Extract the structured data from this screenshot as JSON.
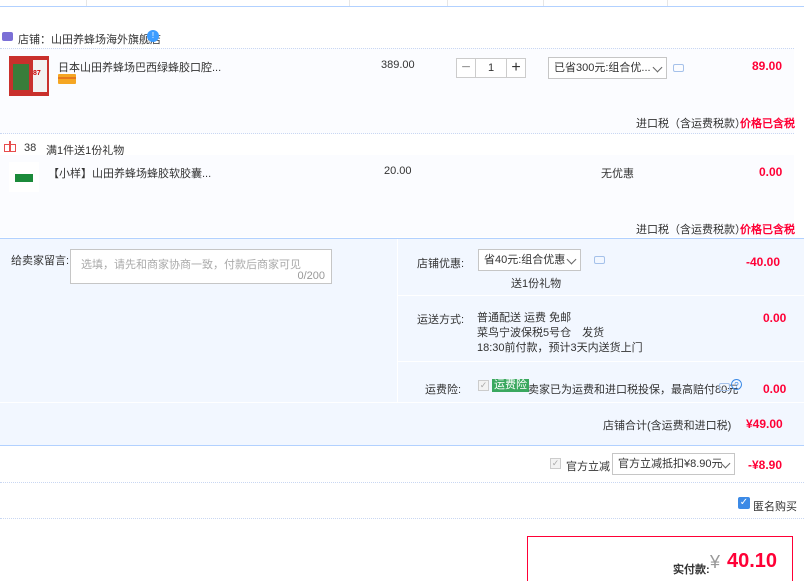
{
  "shop": {
    "label": "店铺：",
    "name": "山田养蜂场海外旗舰店"
  },
  "item1": {
    "title": "日本山田养蜂场巴西绿蜂胶口腔...",
    "thumb_text": "87",
    "price": "389.00",
    "quantity": "1",
    "promo_select": "已省300元:组合优...",
    "subtotal": "89.00",
    "tax_note": "进口税（含运费税款）",
    "tax_status": "价格已含税"
  },
  "gift": {
    "count": "38",
    "text": "满1件送1份礼物",
    "title": "【小样】山田养蜂场蜂胶软胶囊...",
    "price": "20.00",
    "promo": "无优惠",
    "subtotal": "0.00",
    "tax_note": "进口税（含运费税款）",
    "tax_status": "价格已含税"
  },
  "message": {
    "label": "给卖家留言:",
    "placeholder": "选填，请先和商家协商一致，付款后商家可见",
    "counter": "0/200"
  },
  "shop_discount": {
    "label": "店铺优惠:",
    "select": "省40元:组合优惠",
    "gift_note": "送1份礼物",
    "amount": "-40.00"
  },
  "shipping": {
    "label": "运送方式:",
    "line1": "普通配送 运费 免邮",
    "line2": "菜鸟宁波保税5号仓　发货",
    "line3": "18:30前付款，预计3天内送货上门",
    "amount": "0.00"
  },
  "insurance": {
    "label": "运费险:",
    "badge": "运费险",
    "text": "卖家已为运费和进口税投保，最高赔付80元",
    "amount": "0.00"
  },
  "shop_total": {
    "label": "店铺合计(含运费和进口税)",
    "amount": "¥49.00"
  },
  "official": {
    "label": "官方立减",
    "select": "官方立减抵扣¥8.90元",
    "amount": "-¥8.90"
  },
  "anonymous": {
    "label": "匿名购买"
  },
  "payment": {
    "label": "实付款:",
    "currency": "¥",
    "amount": "40.10"
  },
  "colors": {
    "accent_red": "#ff0036",
    "blue_border": "#b2d1ff",
    "panel_bg": "#f2f7ff"
  }
}
